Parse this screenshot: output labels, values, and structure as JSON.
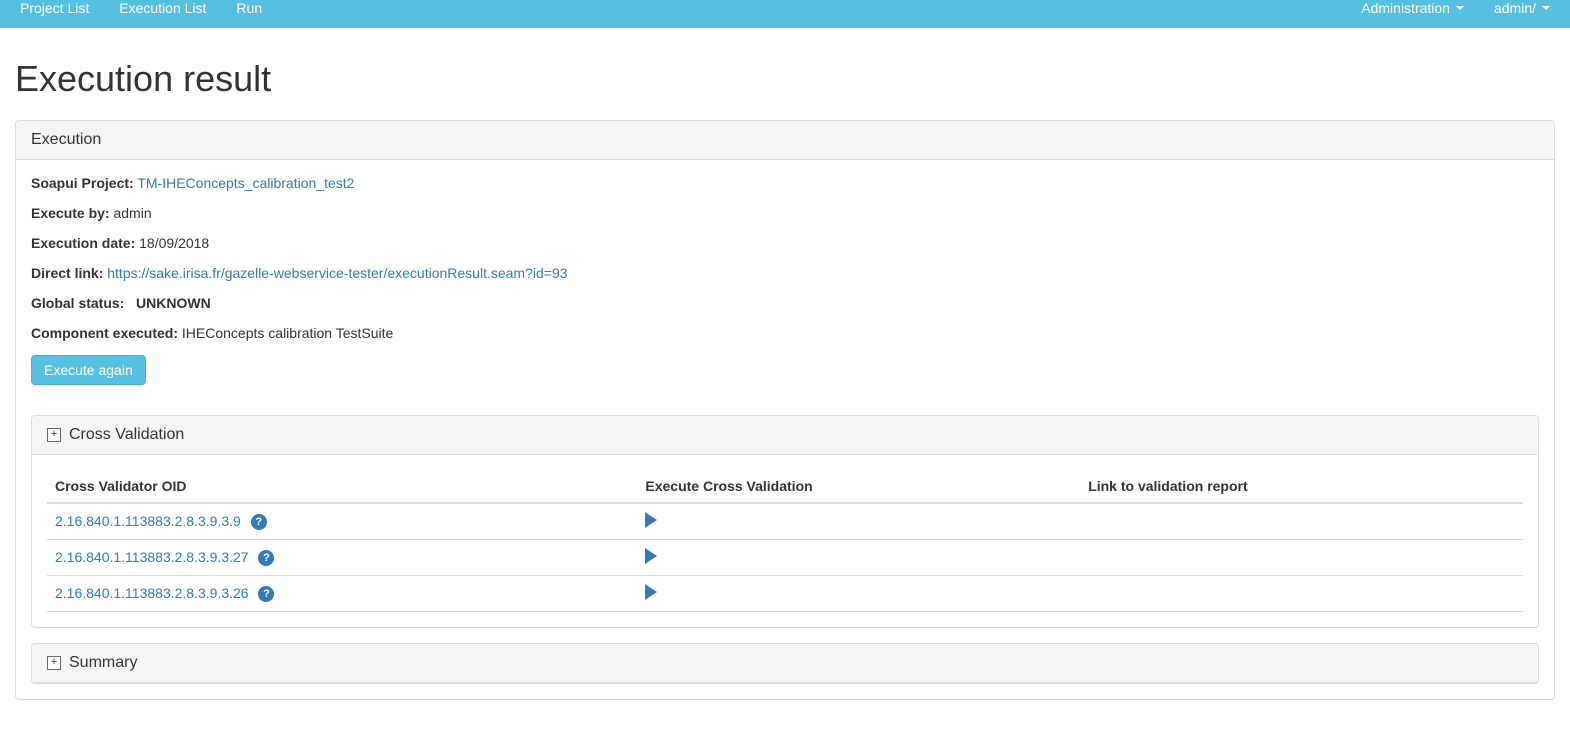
{
  "nav": {
    "left": [
      "Project List",
      "Execution List",
      "Run"
    ],
    "right": [
      "Administration",
      "admin/"
    ]
  },
  "page_title": "Execution result",
  "execution_panel": {
    "title": "Execution",
    "fields": {
      "project_label": "Soapui Project:",
      "project_value": "TM-IHEConcepts_calibration_test2",
      "execute_by_label": "Execute by:",
      "execute_by_value": "admin",
      "date_label": "Execution date:",
      "date_value": "18/09/2018",
      "link_label": "Direct link:",
      "link_value": "https://sake.irisa.fr/gazelle-webservice-tester/executionResult.seam?id=93",
      "status_label": "Global status:",
      "status_value": "UNKNOWN",
      "component_label": "Component executed:",
      "component_value": "IHEConcepts calibration TestSuite"
    },
    "execute_again": "Execute again"
  },
  "cross_validation": {
    "title": "Cross Validation",
    "columns": {
      "oid": "Cross Validator OID",
      "exec": "Execute Cross Validation",
      "report": "Link to validation report"
    },
    "rows": [
      {
        "oid": "2.16.840.1.113883.2.8.3.9.3.9"
      },
      {
        "oid": "2.16.840.1.113883.2.8.3.9.3.27"
      },
      {
        "oid": "2.16.840.1.113883.2.8.3.9.3.26"
      }
    ]
  },
  "summary": {
    "title": "Summary"
  }
}
